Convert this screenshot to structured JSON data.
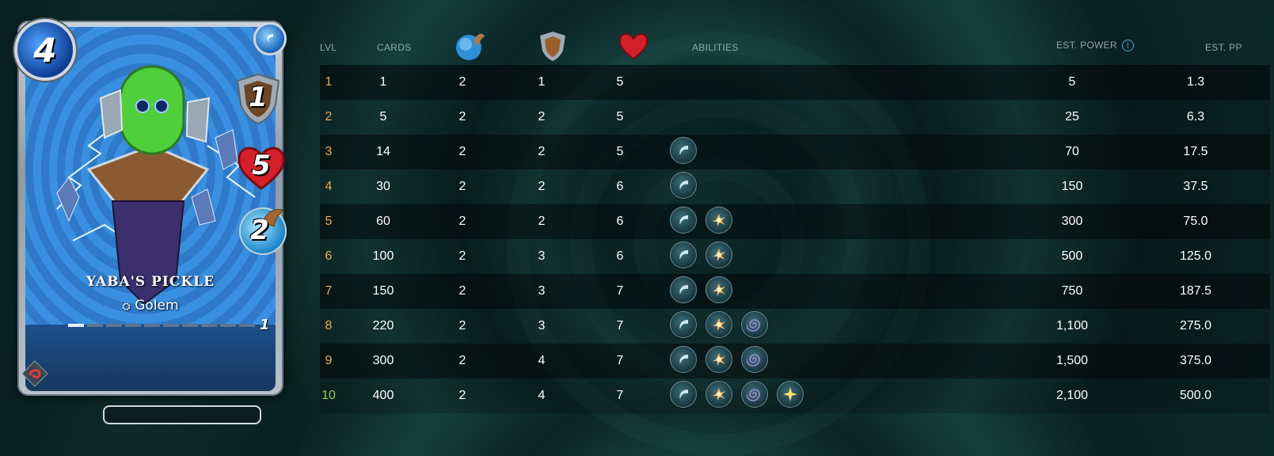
{
  "card": {
    "mana": "4",
    "armor": "1",
    "health": "5",
    "speed": "2",
    "name": "YABA'S PICKLE",
    "type": "Golem",
    "level": "1",
    "level_progress": 0.1
  },
  "table": {
    "headers": {
      "lvl": "LVL",
      "cards": "CARDS",
      "speed_icon": "speed-icon",
      "armor_icon": "armor-icon",
      "health_icon": "health-icon",
      "abilities": "ABILITIES",
      "est_power": "EST. POWER",
      "est_pp": "EST. PP"
    },
    "rows": [
      {
        "lvl": "1",
        "cards": "1",
        "speed": "2",
        "armor": "1",
        "health": "5",
        "abilities": [],
        "power": "5",
        "pp": "1.3"
      },
      {
        "lvl": "2",
        "cards": "5",
        "speed": "2",
        "armor": "2",
        "health": "5",
        "abilities": [],
        "power": "25",
        "pp": "6.3"
      },
      {
        "lvl": "3",
        "cards": "14",
        "speed": "2",
        "armor": "2",
        "health": "5",
        "abilities": [
          "wave-ability-icon"
        ],
        "power": "70",
        "pp": "17.5"
      },
      {
        "lvl": "4",
        "cards": "30",
        "speed": "2",
        "armor": "2",
        "health": "6",
        "abilities": [
          "wave-ability-icon"
        ],
        "power": "150",
        "pp": "37.5"
      },
      {
        "lvl": "5",
        "cards": "60",
        "speed": "2",
        "armor": "2",
        "health": "6",
        "abilities": [
          "wave-ability-icon",
          "burst-ability-icon"
        ],
        "power": "300",
        "pp": "75.0"
      },
      {
        "lvl": "6",
        "cards": "100",
        "speed": "2",
        "armor": "3",
        "health": "6",
        "abilities": [
          "wave-ability-icon",
          "burst-ability-icon"
        ],
        "power": "500",
        "pp": "125.0"
      },
      {
        "lvl": "7",
        "cards": "150",
        "speed": "2",
        "armor": "3",
        "health": "7",
        "abilities": [
          "wave-ability-icon",
          "burst-ability-icon"
        ],
        "power": "750",
        "pp": "187.5"
      },
      {
        "lvl": "8",
        "cards": "220",
        "speed": "2",
        "armor": "3",
        "health": "7",
        "abilities": [
          "wave-ability-icon",
          "burst-ability-icon",
          "spiral-ability-icon"
        ],
        "power": "1,100",
        "pp": "275.0"
      },
      {
        "lvl": "9",
        "cards": "300",
        "speed": "2",
        "armor": "4",
        "health": "7",
        "abilities": [
          "wave-ability-icon",
          "burst-ability-icon",
          "spiral-ability-icon"
        ],
        "power": "1,500",
        "pp": "375.0"
      },
      {
        "lvl": "10",
        "cards": "400",
        "speed": "2",
        "armor": "4",
        "health": "7",
        "abilities": [
          "wave-ability-icon",
          "burst-ability-icon",
          "spiral-ability-icon",
          "sparkle-ability-icon"
        ],
        "power": "2,100",
        "pp": "500.0"
      }
    ]
  },
  "colors": {
    "level_text": "#f2a84a",
    "max_level_text": "#8fd14f",
    "header_text": "#8fa6b3"
  }
}
